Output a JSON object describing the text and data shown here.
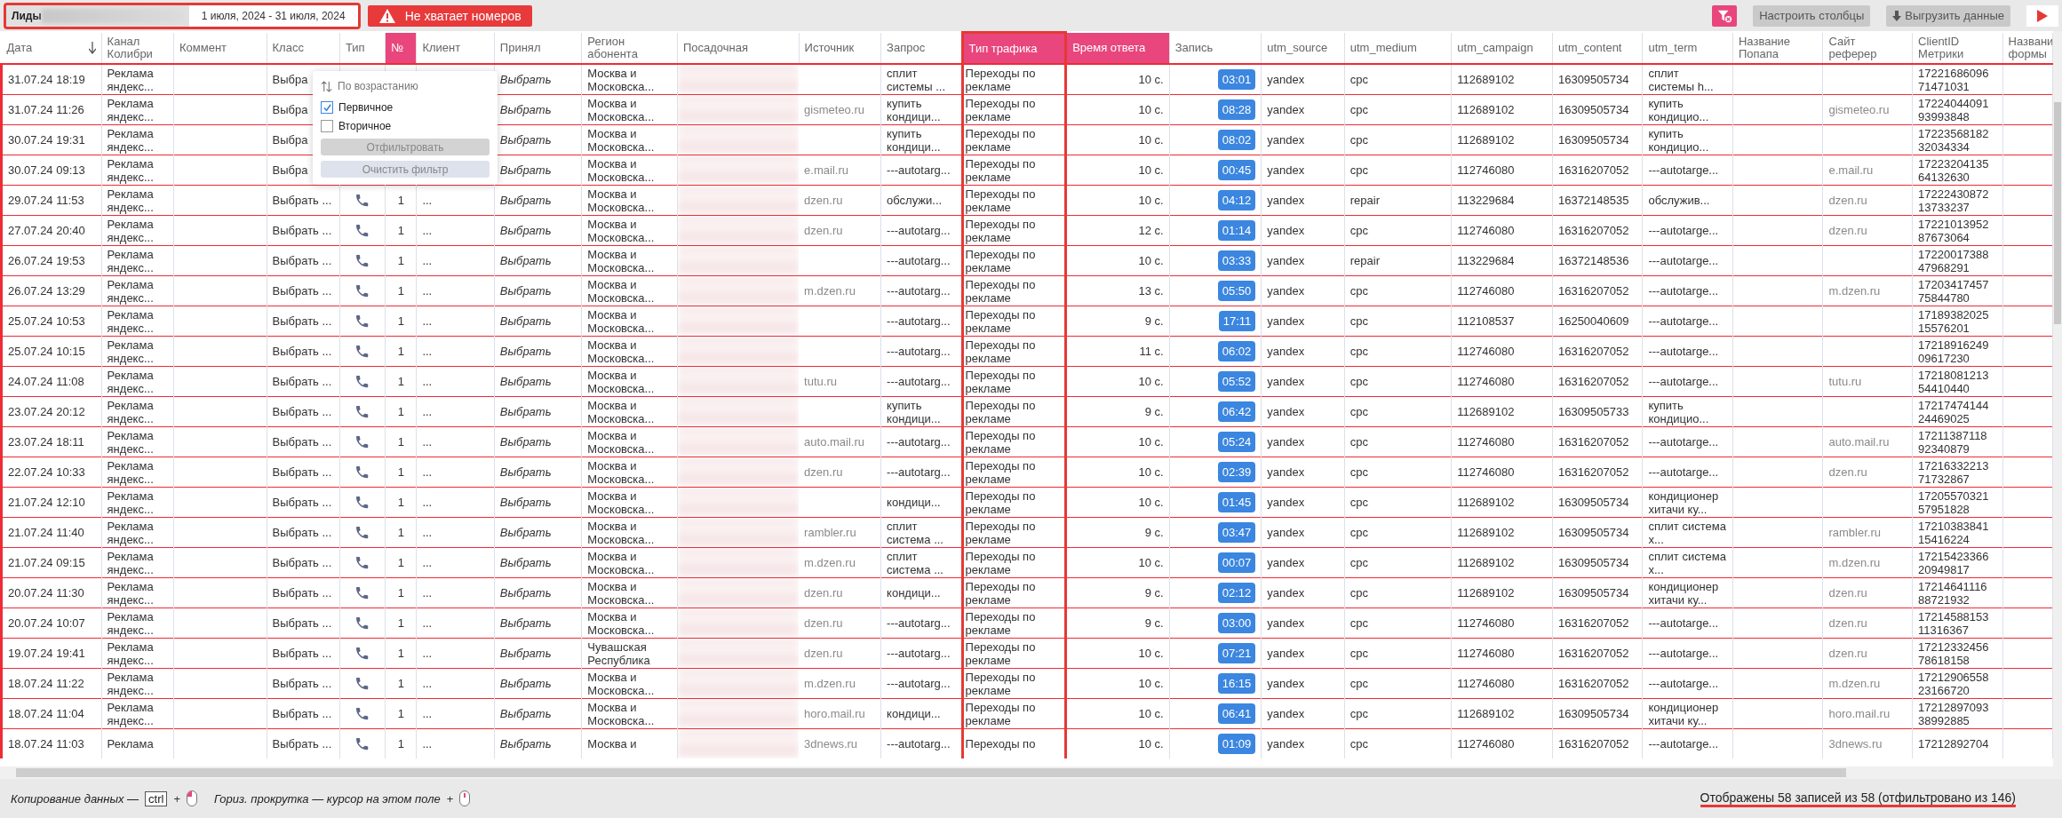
{
  "toolbar": {
    "title": "Лиды",
    "date_range": "1 июля, 2024 - 31 июля, 2024",
    "alert": "Не хватает номеров",
    "buttons": [
      "Настроить столбцы",
      "Выгрузить данные"
    ]
  },
  "table": {
    "columns": [
      {
        "label": "Дата",
        "accent": false,
        "outlined": false,
        "sorted": true
      },
      {
        "label": "Канал Колибри",
        "accent": false,
        "outlined": false,
        "sorted": false
      },
      {
        "label": "Коммент",
        "accent": false,
        "outlined": false,
        "sorted": false
      },
      {
        "label": "Класс",
        "accent": false,
        "outlined": false,
        "sorted": false
      },
      {
        "label": "Тип",
        "accent": false,
        "outlined": false,
        "sorted": false
      },
      {
        "label": "№",
        "accent": true,
        "outlined": false,
        "sorted": false
      },
      {
        "label": "Клиент",
        "accent": false,
        "outlined": false,
        "sorted": false
      },
      {
        "label": "Принял",
        "accent": false,
        "outlined": false,
        "sorted": false
      },
      {
        "label": "Регион абонента",
        "accent": false,
        "outlined": false,
        "sorted": false
      },
      {
        "label": "Посадочная",
        "accent": false,
        "outlined": false,
        "sorted": false
      },
      {
        "label": "Источник",
        "accent": false,
        "outlined": false,
        "sorted": false
      },
      {
        "label": "Запрос",
        "accent": false,
        "outlined": false,
        "sorted": false
      },
      {
        "label": "Тип трафика",
        "accent": true,
        "outlined": true,
        "sorted": false
      },
      {
        "label": "Время ответа",
        "accent": true,
        "outlined": false,
        "sorted": false
      },
      {
        "label": "Запись",
        "accent": false,
        "outlined": false,
        "sorted": false
      },
      {
        "label": "utm_source",
        "accent": false,
        "outlined": false,
        "sorted": false
      },
      {
        "label": "utm_medium",
        "accent": false,
        "outlined": false,
        "sorted": false
      },
      {
        "label": "utm_campaign",
        "accent": false,
        "outlined": false,
        "sorted": false
      },
      {
        "label": "utm_content",
        "accent": false,
        "outlined": false,
        "sorted": false
      },
      {
        "label": "utm_term",
        "accent": false,
        "outlined": false,
        "sorted": false
      },
      {
        "label": "Название Попапа",
        "accent": false,
        "outlined": false,
        "sorted": false
      },
      {
        "label": "Сайт реферер",
        "accent": false,
        "outlined": false,
        "sorted": false
      },
      {
        "label": "ClientID Метрики",
        "accent": false,
        "outlined": false,
        "sorted": false
      },
      {
        "label": "Названи формы",
        "accent": false,
        "outlined": false,
        "sorted": false
      }
    ],
    "rows": [
      {
        "date": "31.07.24 18:19",
        "channel": "Реклама яндекс...",
        "class": "Выбра",
        "accepted": "Выбрать",
        "region": "Москва и Московска...",
        "query": "сплит системы ...",
        "traffic_type": "Переходы по рекламе",
        "response_time": "10 с.",
        "record": "03:01",
        "utm_source": "yandex",
        "utm_medium": "cpc",
        "utm_campaign": "112689102",
        "utm_content": "16309505734",
        "utm_term": "сплит системы h...",
        "client_id": "1722168609671471031"
      },
      {
        "date": "31.07.24 11:26",
        "channel": "Реклама яндекс...",
        "class": "Выбра",
        "accepted": "Выбрать",
        "region": "Москва и Московска...",
        "source": "gismeteo.ru",
        "query": "купить кондици...",
        "traffic_type": "Переходы по рекламе",
        "response_time": "10 с.",
        "record": "08:28",
        "utm_source": "yandex",
        "utm_medium": "cpc",
        "utm_campaign": "112689102",
        "utm_content": "16309505734",
        "utm_term": "купить кондицио...",
        "referrer": "gismeteo.ru",
        "client_id": "1722404409193993848"
      },
      {
        "date": "30.07.24 19:31",
        "channel": "Реклама яндекс...",
        "class": "Выбра",
        "accepted": "Выбрать",
        "region": "Москва и Московска...",
        "query": "купить кондици...",
        "traffic_type": "Переходы по рекламе",
        "response_time": "10 с.",
        "record": "08:02",
        "utm_source": "yandex",
        "utm_medium": "cpc",
        "utm_campaign": "112689102",
        "utm_content": "16309505734",
        "utm_term": "купить кондицио...",
        "client_id": "1722356818232034334"
      },
      {
        "date": "30.07.24 09:13",
        "channel": "Реклама яндекс...",
        "class": "Выбра",
        "accepted": "Выбрать",
        "region": "Москва и Московска...",
        "source": "e.mail.ru",
        "query": "---autotarg...",
        "traffic_type": "Переходы по рекламе",
        "response_time": "10 с.",
        "record": "00:45",
        "utm_source": "yandex",
        "utm_medium": "cpc",
        "utm_campaign": "112746080",
        "utm_content": "16316207052",
        "utm_term": "---autotarge...",
        "referrer": "e.mail.ru",
        "client_id": "1722320413564132630"
      },
      {
        "date": "29.07.24 11:53",
        "channel": "Реклама яндекс...",
        "class": "Выбрать ...",
        "kind": "call",
        "number": "1",
        "client": "...",
        "accepted": "Выбрать",
        "region": "Москва и Московска...",
        "source": "dzen.ru",
        "query": "обслужи...",
        "traffic_type": "Переходы по рекламе",
        "response_time": "10 с.",
        "record": "04:12",
        "utm_source": "yandex",
        "utm_medium": "repair",
        "utm_campaign": "113229684",
        "utm_content": "16372148535",
        "utm_term": "обслужив...",
        "referrer": "dzen.ru",
        "client_id": "1722243087213733237"
      },
      {
        "date": "27.07.24 20:40",
        "channel": "Реклама яндекс...",
        "class": "Выбрать ...",
        "kind": "call",
        "number": "1",
        "client": "...",
        "accepted": "Выбрать",
        "region": "Москва и Московска...",
        "source": "dzen.ru",
        "query": "---autotarg...",
        "traffic_type": "Переходы по рекламе",
        "response_time": "12 с.",
        "record": "01:14",
        "utm_source": "yandex",
        "utm_medium": "cpc",
        "utm_campaign": "112746080",
        "utm_content": "16316207052",
        "utm_term": "---autotarge...",
        "referrer": "dzen.ru",
        "client_id": "1722101395287673064"
      },
      {
        "date": "26.07.24 19:53",
        "channel": "Реклама яндекс...",
        "class": "Выбрать ...",
        "kind": "call",
        "number": "1",
        "client": "...",
        "accepted": "Выбрать",
        "region": "Москва и Московска...",
        "query": "---autotarg...",
        "traffic_type": "Переходы по рекламе",
        "response_time": "10 с.",
        "record": "03:33",
        "utm_source": "yandex",
        "utm_medium": "repair",
        "utm_campaign": "113229684",
        "utm_content": "16372148536",
        "utm_term": "---autotarge...",
        "client_id": "1722001738847968291"
      },
      {
        "date": "26.07.24 13:29",
        "channel": "Реклама яндекс...",
        "class": "Выбрать ...",
        "kind": "call",
        "number": "1",
        "client": "...",
        "accepted": "Выбрать",
        "region": "Москва и Московска...",
        "source": "m.dzen.ru",
        "query": "---autotarg...",
        "traffic_type": "Переходы по рекламе",
        "response_time": "13 с.",
        "record": "05:50",
        "utm_source": "yandex",
        "utm_medium": "cpc",
        "utm_campaign": "112746080",
        "utm_content": "16316207052",
        "utm_term": "---autotarge...",
        "referrer": "m.dzen.ru",
        "client_id": "1720341745775844780"
      },
      {
        "date": "25.07.24 10:53",
        "channel": "Реклама яндекс...",
        "class": "Выбрать ...",
        "kind": "call",
        "number": "1",
        "client": "...",
        "accepted": "Выбрать",
        "region": "Москва и Московска...",
        "query": "---autotarg...",
        "traffic_type": "Переходы по рекламе",
        "response_time": "9 с.",
        "record": "17:11",
        "utm_source": "yandex",
        "utm_medium": "cpc",
        "utm_campaign": "112108537",
        "utm_content": "16250040609",
        "utm_term": "---autotarge...",
        "client_id": "1718938202515576201"
      },
      {
        "date": "25.07.24 10:15",
        "channel": "Реклама яндекс...",
        "class": "Выбрать ...",
        "kind": "call",
        "number": "1",
        "client": "...",
        "accepted": "Выбрать",
        "region": "Москва и Московска...",
        "query": "---autotarg...",
        "traffic_type": "Переходы по рекламе",
        "response_time": "11 с.",
        "record": "06:02",
        "utm_source": "yandex",
        "utm_medium": "cpc",
        "utm_campaign": "112746080",
        "utm_content": "16316207052",
        "utm_term": "---autotarge...",
        "client_id": "1721891624909617230"
      },
      {
        "date": "24.07.24 11:08",
        "channel": "Реклама яндекс...",
        "class": "Выбрать ...",
        "kind": "call",
        "number": "1",
        "client": "...",
        "accepted": "Выбрать",
        "region": "Москва и Московска...",
        "source": "tutu.ru",
        "query": "---autotarg...",
        "traffic_type": "Переходы по рекламе",
        "response_time": "10 с.",
        "record": "05:52",
        "utm_source": "yandex",
        "utm_medium": "cpc",
        "utm_campaign": "112746080",
        "utm_content": "16316207052",
        "utm_term": "---autotarge...",
        "referrer": "tutu.ru",
        "client_id": "1721808121354410440"
      },
      {
        "date": "23.07.24 20:12",
        "channel": "Реклама яндекс...",
        "class": "Выбрать ...",
        "kind": "call",
        "number": "1",
        "client": "...",
        "accepted": "Выбрать",
        "region": "Москва и Московска...",
        "query": "купить кондици...",
        "traffic_type": "Переходы по рекламе",
        "response_time": "9 с.",
        "record": "06:42",
        "utm_source": "yandex",
        "utm_medium": "cpc",
        "utm_campaign": "112689102",
        "utm_content": "16309505733",
        "utm_term": "купить кондицио...",
        "client_id": "1721747414424469025"
      },
      {
        "date": "23.07.24 18:11",
        "channel": "Реклама яндекс...",
        "class": "Выбрать ...",
        "kind": "call",
        "number": "1",
        "client": "...",
        "accepted": "Выбрать",
        "region": "Москва и Московска...",
        "source": "auto.mail.ru",
        "query": "---autotarg...",
        "traffic_type": "Переходы по рекламе",
        "response_time": "10 с.",
        "record": "05:24",
        "utm_source": "yandex",
        "utm_medium": "cpc",
        "utm_campaign": "112746080",
        "utm_content": "16316207052",
        "utm_term": "---autotarge...",
        "referrer": "auto.mail.ru",
        "client_id": "1721138711892340879"
      },
      {
        "date": "22.07.24 10:33",
        "channel": "Реклама яндекс...",
        "class": "Выбрать ...",
        "kind": "call",
        "number": "1",
        "client": "...",
        "accepted": "Выбрать",
        "region": "Москва и Московска...",
        "source": "dzen.ru",
        "query": "---autotarg...",
        "traffic_type": "Переходы по рекламе",
        "response_time": "10 с.",
        "record": "02:39",
        "utm_source": "yandex",
        "utm_medium": "cpc",
        "utm_campaign": "112746080",
        "utm_content": "16316207052",
        "utm_term": "---autotarge...",
        "referrer": "dzen.ru",
        "client_id": "1721633221371732867"
      },
      {
        "date": "21.07.24 12:10",
        "channel": "Реклама яндекс...",
        "class": "Выбрать ...",
        "kind": "call",
        "number": "1",
        "client": "...",
        "accepted": "Выбрать",
        "region": "Москва и Московска...",
        "query": "кондици...",
        "traffic_type": "Переходы по рекламе",
        "response_time": "10 с.",
        "record": "01:45",
        "utm_source": "yandex",
        "utm_medium": "cpc",
        "utm_campaign": "112689102",
        "utm_content": "16309505734",
        "utm_term": "кондиционер хитачи ку...",
        "client_id": "1720557032157951828"
      },
      {
        "date": "21.07.24 11:40",
        "channel": "Реклама яндекс...",
        "class": "Выбрать ...",
        "kind": "call",
        "number": "1",
        "client": "...",
        "accepted": "Выбрать",
        "region": "Москва и Московска...",
        "source": "rambler.ru",
        "query": "сплит система ...",
        "traffic_type": "Переходы по рекламе",
        "response_time": "9 с.",
        "record": "03:47",
        "utm_source": "yandex",
        "utm_medium": "cpc",
        "utm_campaign": "112689102",
        "utm_content": "16309505734",
        "utm_term": "сплит система х...",
        "referrer": "rambler.ru",
        "client_id": "1721038384115416224"
      },
      {
        "date": "21.07.24 09:15",
        "channel": "Реклама яндекс...",
        "class": "Выбрать ...",
        "kind": "call",
        "number": "1",
        "client": "...",
        "accepted": "Выбрать",
        "region": "Москва и Московска...",
        "source": "m.dzen.ru",
        "query": "сплит система ...",
        "traffic_type": "Переходы по рекламе",
        "response_time": "10 с.",
        "record": "00:07",
        "utm_source": "yandex",
        "utm_medium": "cpc",
        "utm_campaign": "112689102",
        "utm_content": "16309505734",
        "utm_term": "сплит система х...",
        "referrer": "m.dzen.ru",
        "client_id": "1721542336620949817"
      },
      {
        "date": "20.07.24 11:30",
        "channel": "Реклама яндекс...",
        "class": "Выбрать ...",
        "kind": "call",
        "number": "1",
        "client": "...",
        "accepted": "Выбрать",
        "region": "Москва и Московска...",
        "source": "dzen.ru",
        "query": "кондици...",
        "traffic_type": "Переходы по рекламе",
        "response_time": "9 с.",
        "record": "02:12",
        "utm_source": "yandex",
        "utm_medium": "cpc",
        "utm_campaign": "112689102",
        "utm_content": "16309505734",
        "utm_term": "кондиционер хитачи ку...",
        "referrer": "dzen.ru",
        "client_id": "1721464111688721932"
      },
      {
        "date": "20.07.24 10:07",
        "channel": "Реклама яндекс...",
        "class": "Выбрать ...",
        "kind": "call",
        "number": "1",
        "client": "...",
        "accepted": "Выбрать",
        "region": "Москва и Московска...",
        "source": "dzen.ru",
        "query": "---autotarg...",
        "traffic_type": "Переходы по рекламе",
        "response_time": "9 с.",
        "record": "03:00",
        "utm_source": "yandex",
        "utm_medium": "cpc",
        "utm_campaign": "112746080",
        "utm_content": "16316207052",
        "utm_term": "---autotarge...",
        "referrer": "dzen.ru",
        "client_id": "1721458815311316367"
      },
      {
        "date": "19.07.24 19:41",
        "channel": "Реклама яндекс...",
        "class": "Выбрать ...",
        "kind": "call",
        "number": "1",
        "client": "...",
        "accepted": "Выбрать",
        "region": "Чувашская Республика",
        "source": "dzen.ru",
        "query": "---autotarg...",
        "traffic_type": "Переходы по рекламе",
        "response_time": "10 с.",
        "record": "07:21",
        "utm_source": "yandex",
        "utm_medium": "cpc",
        "utm_campaign": "112746080",
        "utm_content": "16316207052",
        "utm_term": "---autotarge...",
        "referrer": "dzen.ru",
        "client_id": "1721233245678618158"
      },
      {
        "date": "18.07.24 11:22",
        "channel": "Реклама яндекс...",
        "class": "Выбрать ...",
        "kind": "call",
        "number": "1",
        "client": "...",
        "accepted": "Выбрать",
        "region": "Москва и Московска...",
        "source": "m.dzen.ru",
        "query": "---autotarg...",
        "traffic_type": "Переходы по рекламе",
        "response_time": "10 с.",
        "record": "16:15",
        "utm_source": "yandex",
        "utm_medium": "cpc",
        "utm_campaign": "112746080",
        "utm_content": "16316207052",
        "utm_term": "---autotarge...",
        "referrer": "m.dzen.ru",
        "client_id": "1721290655823166720"
      },
      {
        "date": "18.07.24 11:04",
        "channel": "Реклама яндекс...",
        "class": "Выбрать ...",
        "kind": "call",
        "number": "1",
        "client": "...",
        "accepted": "Выбрать",
        "region": "Москва и Московска...",
        "source": "horo.mail.ru",
        "query": "кондици...",
        "traffic_type": "Переходы по рекламе",
        "response_time": "10 с.",
        "record": "06:41",
        "utm_source": "yandex",
        "utm_medium": "cpc",
        "utm_campaign": "112689102",
        "utm_content": "16309505734",
        "utm_term": "кондиционер хитачи ку...",
        "referrer": "horo.mail.ru",
        "client_id": "1721289709338992885"
      },
      {
        "date": "18.07.24 11:03",
        "channel": "Реклама",
        "class": "Выбрать ...",
        "kind": "call",
        "number": "1",
        "client": "...",
        "accepted": "Выбрать",
        "region": "Москва и",
        "source": "3dnews.ru",
        "query": "---autotarg...",
        "traffic_type": "Переходы по",
        "response_time": "10 с.",
        "record": "01:09",
        "utm_source": "yandex",
        "utm_medium": "cpc",
        "utm_campaign": "112746080",
        "utm_content": "16316207052",
        "utm_term": "---autotarge...",
        "referrer": "3dnews.ru",
        "client_id": "17212892704"
      }
    ]
  },
  "filter_popup": {
    "sort": "По возрастанию",
    "options": [
      {
        "label": "Первичное",
        "checked": true
      },
      {
        "label": "Вторичное",
        "checked": false
      }
    ],
    "buttons": [
      "Отфильтровать",
      "Очистить фильтр"
    ]
  },
  "footer": {
    "hint_copy": "Копирование данных —",
    "key": "ctrl",
    "plus": "+",
    "hint_scroll": "Гориз. прокрутка — курсор на этом поле",
    "plus_2": "+",
    "records": "Отображены 58 записей из 58 (отфильтровано из 146)"
  }
}
